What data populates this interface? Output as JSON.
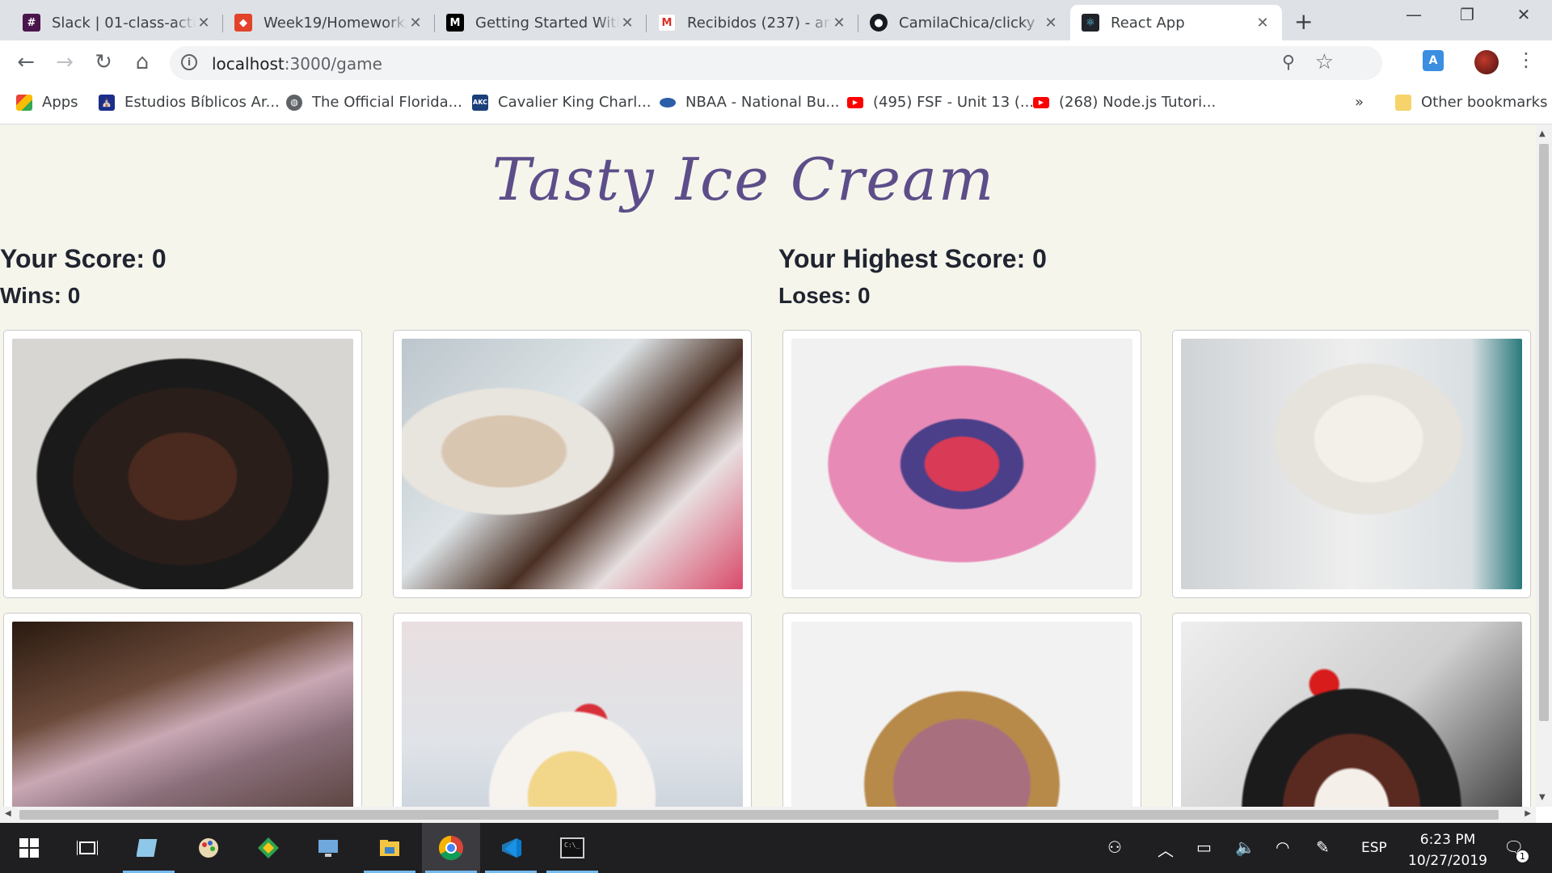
{
  "tabs": [
    {
      "title": "Slack | 01-class-activi",
      "icon": "slack-icon",
      "color": "#4a154b"
    },
    {
      "title": "Week19/Homework/",
      "icon": "gitlab-icon",
      "color": "#e24329"
    },
    {
      "title": "Getting Started With",
      "icon": "medium-icon",
      "color": "#000000"
    },
    {
      "title": "Recibidos (237) - and",
      "icon": "gmail-icon",
      "color": "#d93025"
    },
    {
      "title": "CamilaChica/clicky",
      "icon": "github-icon",
      "color": "#161b22"
    },
    {
      "title": "React App",
      "icon": "react-icon",
      "color": "#20232a"
    }
  ],
  "omnibox": {
    "host": "localhost",
    "path": ":3000/game"
  },
  "bookmarks": [
    {
      "label": "Apps",
      "icon": "apps-grid-icon"
    },
    {
      "label": "Estudios Bíblicos Ar...",
      "icon": "bookmark-site-icon"
    },
    {
      "label": "The Official Florida...",
      "icon": "globe-icon"
    },
    {
      "label": "Cavalier King Charl...",
      "icon": "akc-icon"
    },
    {
      "label": "NBAA - National Bu...",
      "icon": "nbaa-icon"
    },
    {
      "label": "(495) FSF - Unit 13 (...",
      "icon": "youtube-icon"
    },
    {
      "label": "(268) Node.js Tutori...",
      "icon": "youtube-icon"
    },
    {
      "label": "Other bookmarks",
      "icon": "folder-icon"
    }
  ],
  "bookmarks_overflow": "»",
  "game": {
    "title": "Tasty Ice Cream",
    "score_label": "Your Score: 0",
    "wins_label": "Wins: 0",
    "high_score_label": "Your Highest Score: 0",
    "loses_label": "Loses: 0",
    "cards": [
      {
        "name": "chocolate-ice-cream-bowl"
      },
      {
        "name": "brownie-sundae-glass"
      },
      {
        "name": "berry-waffle"
      },
      {
        "name": "cookies-and-cream-cup"
      },
      {
        "name": "chocolate-popsicles"
      },
      {
        "name": "strawberry-cupcake"
      },
      {
        "name": "berry-ice-cream-cone"
      },
      {
        "name": "cherry-sundae-bowl"
      }
    ]
  },
  "taskbar": {
    "language": "ESP",
    "time": "6:23 PM",
    "date": "10/27/2019",
    "notifications": "1"
  }
}
